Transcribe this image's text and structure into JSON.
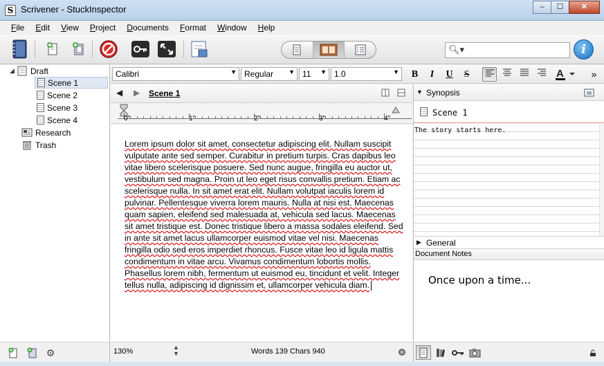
{
  "window": {
    "title": "Scrivener - StuckInspector",
    "minimize": "–",
    "maximize": "☐",
    "close": "✕"
  },
  "menu": [
    "File",
    "Edit",
    "View",
    "Project",
    "Documents",
    "Format",
    "Window",
    "Help"
  ],
  "toolbar": {
    "search_placeholder": "",
    "info": "i"
  },
  "binder": {
    "draft": "Draft",
    "scenes": [
      "Scene 1",
      "Scene 2",
      "Scene 3",
      "Scene 4"
    ],
    "research": "Research",
    "trash": "Trash"
  },
  "format": {
    "font": "Calibri",
    "style": "Regular",
    "size": "11",
    "spacing": "1.0",
    "bold": "B",
    "italic": "I",
    "underline": "U",
    "strike": "S",
    "more": "»"
  },
  "editor": {
    "title": "Scene 1",
    "ruler": [
      "0\"",
      "1\"",
      "2\"",
      "3\"",
      "4\""
    ],
    "body": "Lorem ipsum dolor sit amet, consectetur adipiscing elit. Nullam suscipit vulputate ante sed semper. Curabitur in pretium turpis. Cras dapibus leo vitae libero scelerisque posuere. Sed nunc augue, fringilla eu auctor ut, vestibulum sed magna. Proin ut leo eget risus convallis pretium. Etiam ac scelerisque nulla. In sit amet erat elit. Nullam volutpat iaculis lorem id pulvinar. Pellentesque viverra lorem mauris. Nulla at nisi est. Maecenas quam sapien, eleifend sed malesuada at, vehicula sed lacus. Maecenas sit amet tristique est. Donec tristique libero a massa sodales eleifend. Sed in ante sit amet lacus ullamcorper euismod vitae vel nisi. Maecenas fringilla odio sed eros imperdiet rhoncus. Fusce vitae leo id ligula mattis condimentum in vitae arcu. Vivamus condimentum lobortis mollis. Phasellus lorem nibh, fermentum ut euismod eu, tincidunt et velit. Integer tellus nulla, adipiscing id dignissim et, ullamcorper vehicula diam.",
    "zoom": "130%",
    "wordcount": "Words 139 Chars 940"
  },
  "inspector": {
    "synopsis_label": "Synopsis",
    "doc_title": "Scene 1",
    "synopsis_text": "The story starts here.",
    "general_label": "General",
    "notes_label": "Document Notes",
    "notes_text": "Once upon a time..."
  }
}
